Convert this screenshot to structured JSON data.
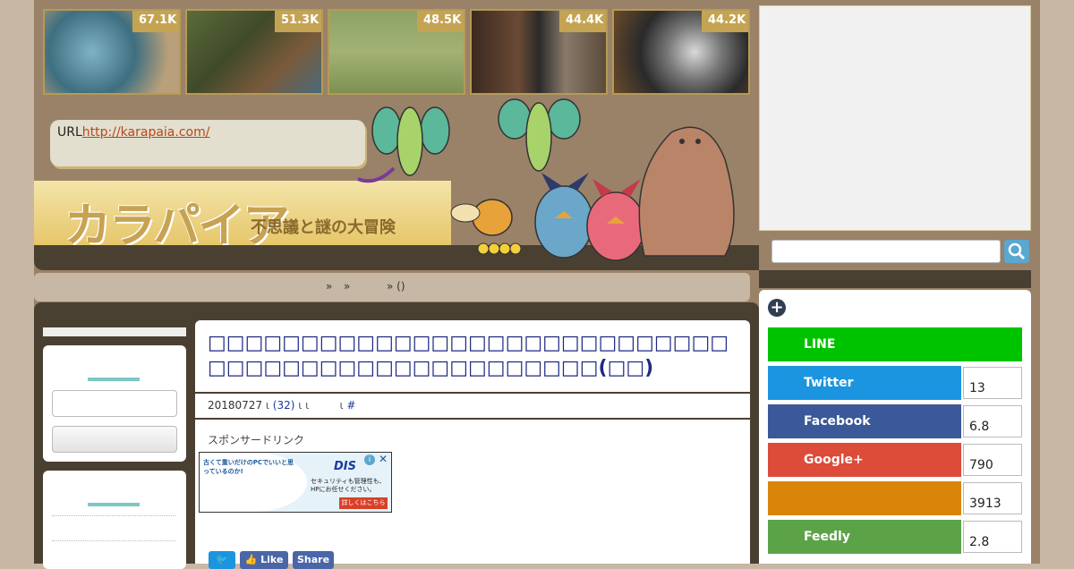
{
  "thumbnails": [
    {
      "count": "67.1K",
      "icon": "photo-mite"
    },
    {
      "count": "51.3K",
      "icon": "photo-fisherman-bear"
    },
    {
      "count": "48.5K",
      "icon": "photo-dog-field"
    },
    {
      "count": "44.4K",
      "icon": "photo-two-men"
    },
    {
      "count": "44.2K",
      "icon": "photo-husky"
    }
  ],
  "header": {
    "url_label": "URL",
    "url_link": "http://karapaia.com/",
    "logo_text": "カラパイア",
    "logo_subtitle": "不思議と謎の大冒険"
  },
  "breadcrumb": {
    "sep1": "»",
    "sep2": "»",
    "sep3": "» ()"
  },
  "article": {
    "title": "□□□□□□□□□□□□□□□□□□□□□□□□□□□□□□□□□□□□□□□□□□□□□□□□□(□□)",
    "date": "20180727",
    "comments": "(32)",
    "tag": "#",
    "sponsor_label": "スポンサードリンク",
    "ad_text_1": "古くて重いだけのPCでいいと思っているのか!",
    "ad_text_2": "セキュリティも管理性も、HPにお任せください。",
    "ad_brand": "DIS",
    "ad_cta": "詳しくはこちら"
  },
  "share_buttons": {
    "twitter": "",
    "like": "Like",
    "share": "Share"
  },
  "social": [
    {
      "name": "LINE",
      "count": "",
      "color": "#00c300"
    },
    {
      "name": "Twitter",
      "count": "13",
      "color": "#1b95e0"
    },
    {
      "name": "Facebook",
      "count": "6.8",
      "color": "#3b5998"
    },
    {
      "name": "Google+",
      "count": "790",
      "color": "#dd4b39"
    },
    {
      "name": "",
      "count": "3913",
      "color": "#d9850a"
    },
    {
      "name": "Feedly",
      "count": "2.8",
      "color": "#5ca348"
    }
  ]
}
